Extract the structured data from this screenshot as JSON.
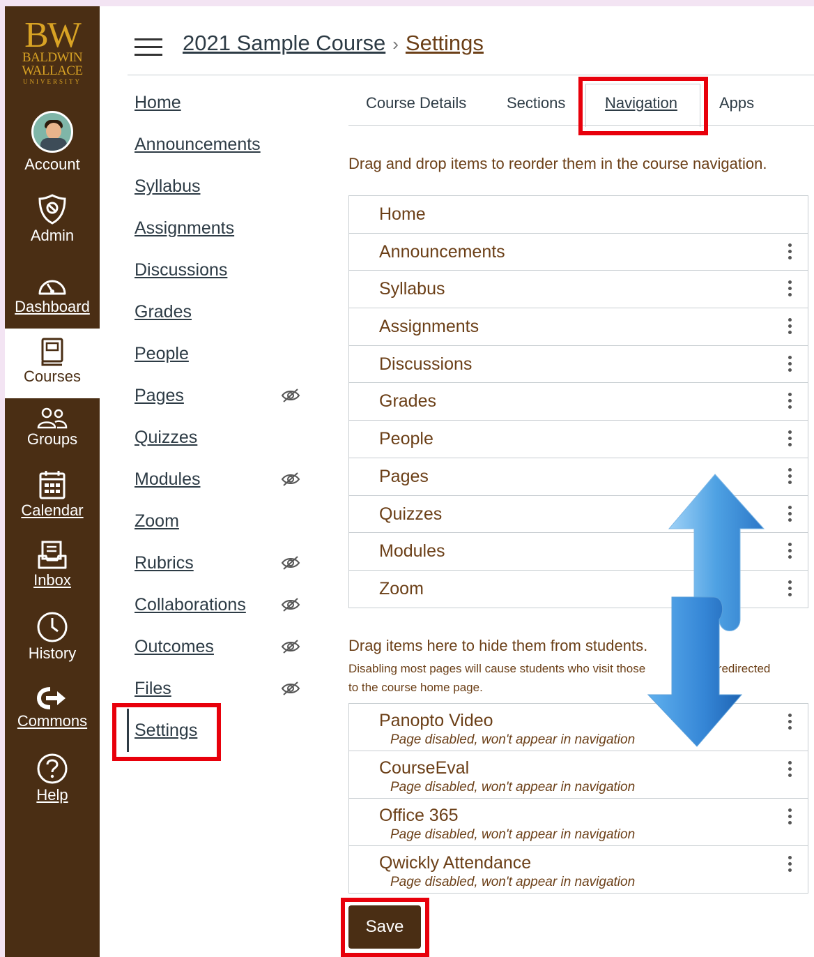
{
  "logo": {
    "line1": "BW",
    "line2": "BALDWIN",
    "line3": "WALLACE",
    "line4": "UNIVERSITY"
  },
  "global_nav": [
    {
      "label": "Account",
      "icon": "avatar"
    },
    {
      "label": "Admin",
      "icon": "shield-icon"
    },
    {
      "label": "Dashboard",
      "icon": "speedometer-icon"
    },
    {
      "label": "Courses",
      "icon": "book-icon",
      "active": true
    },
    {
      "label": "Groups",
      "icon": "people-icon"
    },
    {
      "label": "Calendar",
      "icon": "calendar-icon"
    },
    {
      "label": "Inbox",
      "icon": "inbox-icon"
    },
    {
      "label": "History",
      "icon": "clock-icon"
    },
    {
      "label": "Commons",
      "icon": "commons-arrow-icon"
    },
    {
      "label": "Help",
      "icon": "question-icon"
    }
  ],
  "breadcrumb": {
    "course": "2021 Sample Course",
    "separator": "›",
    "current": "Settings"
  },
  "course_nav": [
    {
      "label": "Home"
    },
    {
      "label": "Announcements"
    },
    {
      "label": "Syllabus"
    },
    {
      "label": "Assignments"
    },
    {
      "label": "Discussions"
    },
    {
      "label": "Grades"
    },
    {
      "label": "People"
    },
    {
      "label": "Pages",
      "hidden": true
    },
    {
      "label": "Quizzes"
    },
    {
      "label": "Modules",
      "hidden": true
    },
    {
      "label": "Zoom"
    },
    {
      "label": "Rubrics",
      "hidden": true
    },
    {
      "label": "Collaborations",
      "hidden": true
    },
    {
      "label": "Outcomes",
      "hidden": true
    },
    {
      "label": "Files",
      "hidden": true
    },
    {
      "label": "Settings",
      "active": true
    }
  ],
  "tabs": [
    {
      "label": "Course Details"
    },
    {
      "label": "Sections"
    },
    {
      "label": "Navigation",
      "active": true
    },
    {
      "label": "Apps"
    }
  ],
  "instructions": "Drag and drop items to reorder them in the course navigation.",
  "enabled_items": [
    "Home",
    "Announcements",
    "Syllabus",
    "Assignments",
    "Discussions",
    "Grades",
    "People",
    "Pages",
    "Quizzes",
    "Modules",
    "Zoom"
  ],
  "hidden_section": {
    "title": "Drag items here to hide them from students.",
    "note": "Disabling most pages will cause students who visit those pages to be redirected to the course home page.",
    "note_visible_part1": "Disabling most pages will cause students who visit those",
    "note_visible_part2": "be redirected",
    "note_line2": "to the course home page."
  },
  "disabled_items": [
    {
      "title": "Panopto Video",
      "status": "Page disabled, won't appear in navigation"
    },
    {
      "title": "CourseEval",
      "status": "Page disabled, won't appear in navigation"
    },
    {
      "title": "Office 365",
      "status": "Page disabled, won't appear in navigation"
    },
    {
      "title": "Qwickly Attendance",
      "status": "Page disabled, won't appear in navigation"
    }
  ],
  "save_label": "Save",
  "colors": {
    "brand_brown": "#4a2e14",
    "text_brown": "#6b3f17",
    "gold": "#d9a324",
    "highlight_red": "#e8000b",
    "arrow_blue": "#3d8fd6"
  }
}
